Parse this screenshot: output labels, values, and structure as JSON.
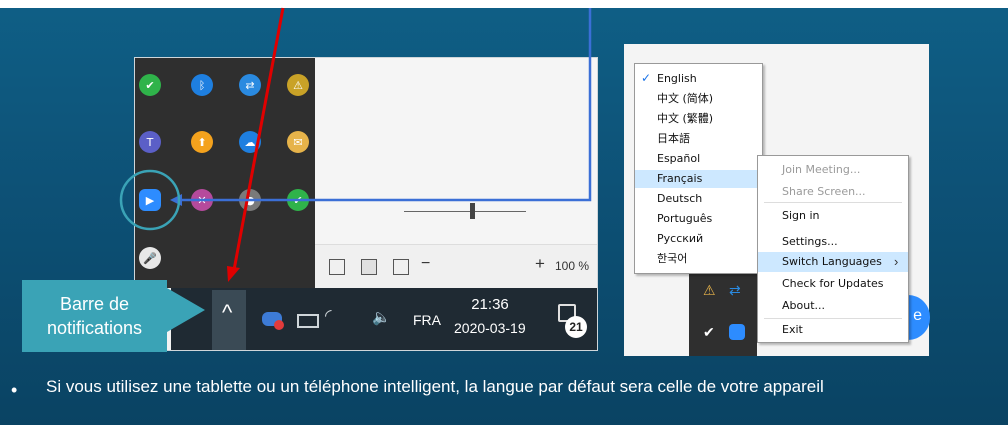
{
  "callout": {
    "line1": "Barre de",
    "line2": "notifications"
  },
  "tray_icons": [
    {
      "name": "shield-check-icon",
      "glyph": "✔",
      "color": "#2fb34a"
    },
    {
      "name": "bluetooth-icon",
      "glyph": "ᛒ",
      "color": "#1e7fe0"
    },
    {
      "name": "share-icon",
      "glyph": "⇄",
      "color": "#2a8ae0"
    },
    {
      "name": "sync-icon",
      "glyph": "⚠",
      "color": "#c9a227"
    },
    {
      "name": "teams-icon",
      "glyph": "T",
      "color": "#5b5fc7"
    },
    {
      "name": "update-icon",
      "glyph": "⬆",
      "color": "#f4a21d"
    },
    {
      "name": "onedrive-icon",
      "glyph": "☁",
      "color": "#1e7fe0"
    },
    {
      "name": "mail-icon",
      "glyph": "✉",
      "color": "#e6b34a"
    },
    {
      "name": "zoom-icon",
      "glyph": "▶",
      "color": "#2d8cff"
    },
    {
      "name": "network-icon",
      "glyph": "✕",
      "color": "#b54a9c"
    },
    {
      "name": "drive-icon",
      "glyph": "●",
      "color": "#7a7a7a"
    },
    {
      "name": "defender-icon",
      "glyph": "✔",
      "color": "#2fb34a"
    },
    {
      "name": "microphone-icon",
      "glyph": "🎤",
      "color": "#e8e8e8"
    }
  ],
  "taskbar": {
    "chevron": "^",
    "language": "FRA",
    "time": "21:36",
    "date": "2020-03-19",
    "notification_count": "21"
  },
  "status": {
    "zoom_minus": "−",
    "zoom_plus": "+",
    "zoom_level": "100 %"
  },
  "language_menu": {
    "items": [
      "English",
      "中文 (简体)",
      "中文 (繁體)",
      "日本語",
      "Español",
      "Français",
      "Deutsch",
      "Português",
      "Русский",
      "한국어"
    ],
    "checked": "English",
    "highlighted": "Français"
  },
  "zoom_menu": {
    "items": [
      {
        "label": "Join Meeting...",
        "disabled": true
      },
      {
        "label": "Share Screen...",
        "disabled": true
      },
      {
        "label": "Sign in",
        "disabled": false
      },
      {
        "label": "Settings...",
        "disabled": false
      },
      {
        "label": "Switch Languages",
        "disabled": false,
        "highlighted": true
      },
      {
        "label": "Check for Updates",
        "disabled": false
      },
      {
        "label": "About...",
        "disabled": false
      },
      {
        "label": "Exit",
        "disabled": false
      }
    ],
    "submenu_arrow": "›",
    "pill_letter": "e"
  },
  "bullet": {
    "marker": "•",
    "text": "Si vous utilisez une tablette ou un téléphone intelligent, la langue par défaut sera celle de votre appareil"
  },
  "colors": {
    "background": "#0d5176",
    "callout": "#3aa3b6",
    "arrow_red": "#e00000",
    "arrow_blue": "#3b6fd6",
    "zoom_blue": "#2d8cff"
  }
}
